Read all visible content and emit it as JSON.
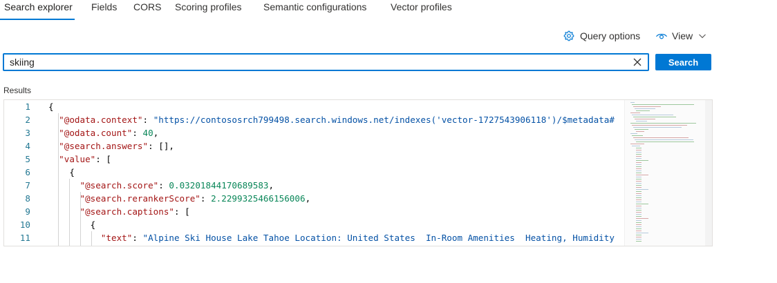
{
  "tabs": [
    {
      "label": "Search explorer",
      "active": true
    },
    {
      "label": "Fields",
      "active": false
    },
    {
      "label": "CORS",
      "active": false
    },
    {
      "label": "Scoring profiles",
      "active": false
    },
    {
      "label": "Semantic configurations",
      "active": false
    },
    {
      "label": "Vector profiles",
      "active": false
    }
  ],
  "toolbar": {
    "query_options_label": "Query options",
    "view_label": "View",
    "query_options_icon": "gear-icon",
    "view_icon": "eye-icon",
    "view_chevron_icon": "chevron-down-icon"
  },
  "search": {
    "value": "skiing",
    "clear_icon": "close-icon",
    "button_label": "Search"
  },
  "results": {
    "label": "Results",
    "lines": [
      {
        "num": "1",
        "text": "{"
      },
      {
        "num": "2",
        "text": "  \"@odata.context\": \"https://contososrch799498.search.windows.net/indexes('vector-1727543906118')/$metadata#"
      },
      {
        "num": "3",
        "text": "  \"@odata.count\": 40,"
      },
      {
        "num": "4",
        "text": "  \"@search.answers\": [],"
      },
      {
        "num": "5",
        "text": "  \"value\": ["
      },
      {
        "num": "6",
        "text": "    {"
      },
      {
        "num": "7",
        "text": "      \"@search.score\": 0.03201844170689583,"
      },
      {
        "num": "8",
        "text": "      \"@search.rerankerScore\": 2.2299325466156006,"
      },
      {
        "num": "9",
        "text": "      \"@search.captions\": ["
      },
      {
        "num": "10",
        "text": "        {"
      },
      {
        "num": "11",
        "text": "          \"text\": \"Alpine Ski House Lake Tahoe Location: United States  In-Room Amenities  Heating, Humidity"
      }
    ]
  },
  "colors": {
    "accent": "#0078d4",
    "json_key": "#a31515",
    "json_string": "#0451a5",
    "json_number": "#098658",
    "line_number": "#237893"
  }
}
